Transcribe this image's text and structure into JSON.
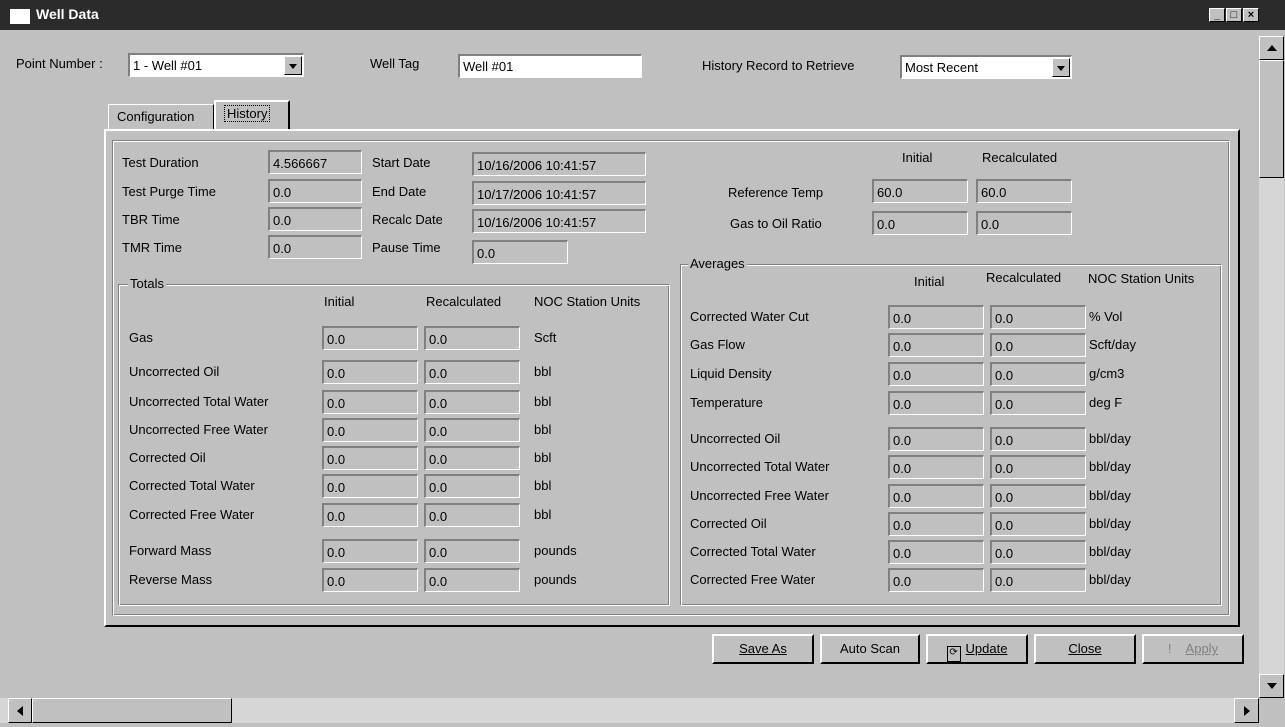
{
  "window": {
    "title": "Well Data"
  },
  "header": {
    "point_number_label": "Point Number :",
    "point_number_value": "1 - Well #01",
    "well_tag_label": "Well Tag",
    "well_tag_value": "Well #01",
    "history_label": "History Record to Retrieve",
    "history_value": "Most Recent"
  },
  "tabs": [
    {
      "label": "Configuration"
    },
    {
      "label": "History"
    }
  ],
  "test": {
    "test_duration_label": "Test Duration",
    "test_duration": "4.566667",
    "purge_label": "Test Purge Time",
    "purge": "0.0",
    "tbr_label": "TBR Time",
    "tbr": "0.0",
    "tmr_label": "TMR Time",
    "tmr": "0.0",
    "start_label": "Start Date",
    "start": "10/16/2006 10:41:57",
    "end_label": "End Date",
    "end": "10/17/2006 10:41:57",
    "recalc_label": "Recalc Date",
    "recalc": "10/16/2006 10:41:57",
    "pause_label": "Pause Time",
    "pause": "0.0"
  },
  "reference": {
    "initial_header": "Initial",
    "recalc_header": "Recalculated",
    "ref_temp_label": "Reference Temp",
    "ref_temp_initial": "60.0",
    "ref_temp_recalc": "60.0",
    "gor_label": "Gas to Oil Ratio",
    "gor_initial": "0.0",
    "gor_recalc": "0.0"
  },
  "totals": {
    "title": "Totals",
    "col_initial": "Initial",
    "col_recalc": "Recalculated",
    "col_units": "NOC Station Units",
    "rows": [
      {
        "label": "Gas",
        "initial": "0.0",
        "recalc": "0.0",
        "units": "Scft"
      },
      {
        "label": "Uncorrected Oil",
        "initial": "0.0",
        "recalc": "0.0",
        "units": "bbl"
      },
      {
        "label": "Uncorrected Total Water",
        "initial": "0.0",
        "recalc": "0.0",
        "units": "bbl"
      },
      {
        "label": "Uncorrected Free Water",
        "initial": "0.0",
        "recalc": "0.0",
        "units": "bbl"
      },
      {
        "label": "Corrected Oil",
        "initial": "0.0",
        "recalc": "0.0",
        "units": "bbl"
      },
      {
        "label": "Corrected Total Water",
        "initial": "0.0",
        "recalc": "0.0",
        "units": "bbl"
      },
      {
        "label": "Corrected Free Water",
        "initial": "0.0",
        "recalc": "0.0",
        "units": "bbl"
      },
      {
        "label": "Forward Mass",
        "initial": "0.0",
        "recalc": "0.0",
        "units": "pounds"
      },
      {
        "label": "Reverse Mass",
        "initial": "0.0",
        "recalc": "0.0",
        "units": "pounds"
      }
    ]
  },
  "averages": {
    "title": "Averages",
    "col_initial": "Initial",
    "col_recalc": "Recalculated",
    "col_units": "NOC Station Units",
    "rows": [
      {
        "label": "Corrected Water Cut",
        "initial": "0.0",
        "recalc": "0.0",
        "units": "% Vol"
      },
      {
        "label": "Gas Flow",
        "initial": "0.0",
        "recalc": "0.0",
        "units": "Scft/day"
      },
      {
        "label": "Liquid Density",
        "initial": "0.0",
        "recalc": "0.0",
        "units": "g/cm3"
      },
      {
        "label": "Temperature",
        "initial": "0.0",
        "recalc": "0.0",
        "units": "deg F"
      },
      {
        "label": "Uncorrected Oil",
        "initial": "0.0",
        "recalc": "0.0",
        "units": "bbl/day"
      },
      {
        "label": "Uncorrected Total Water",
        "initial": "0.0",
        "recalc": "0.0",
        "units": "bbl/day"
      },
      {
        "label": "Uncorrected Free Water",
        "initial": "0.0",
        "recalc": "0.0",
        "units": "bbl/day"
      },
      {
        "label": "Corrected Oil",
        "initial": "0.0",
        "recalc": "0.0",
        "units": "bbl/day"
      },
      {
        "label": "Corrected Total Water",
        "initial": "0.0",
        "recalc": "0.0",
        "units": "bbl/day"
      },
      {
        "label": "Corrected Free Water",
        "initial": "0.0",
        "recalc": "0.0",
        "units": "bbl/day"
      }
    ]
  },
  "buttons": {
    "save_as": "Save As",
    "auto_scan": "Auto Scan",
    "update": "Update",
    "close": "Close",
    "apply": "Apply"
  },
  "icons": {
    "update": "refresh-icon",
    "apply": "exclamation-icon"
  }
}
